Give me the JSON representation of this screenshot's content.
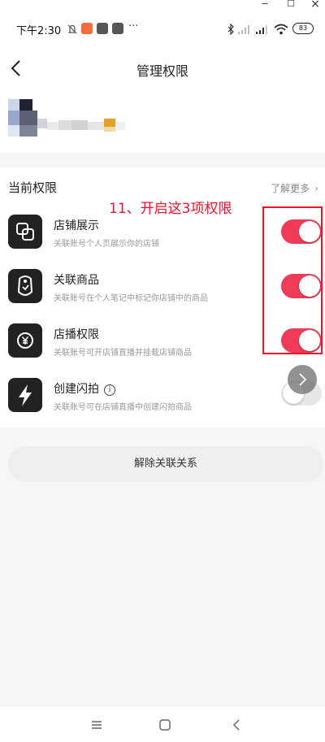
{
  "window": {
    "minimize": "−",
    "maximize": "☐",
    "close": "×"
  },
  "status_bar": {
    "time": "下午2:30",
    "more": "···",
    "battery": "83"
  },
  "header": {
    "title": "管理权限",
    "back_icon": "chevron-left-icon"
  },
  "permissions": {
    "section_title": "当前权限",
    "learn_more": "了解更多",
    "items": [
      {
        "title": "店铺展示",
        "desc": "关联账号个人页展示你的店铺",
        "icon": "store-display-icon",
        "enabled": true
      },
      {
        "title": "关联商品",
        "desc": "关联账号在个人笔记中标记你店铺中的商品",
        "icon": "tag-icon",
        "enabled": true
      },
      {
        "title": "店播权限",
        "desc": "关联账号可开店铺直播并挂载店铺商品",
        "icon": "yuan-icon",
        "enabled": true
      },
      {
        "title": "创建闪拍",
        "desc": "关联账号可在店铺直播中创建闪拍商品",
        "icon": "lightning-icon",
        "enabled": false,
        "info": "i"
      }
    ]
  },
  "annotation": {
    "text": "11、开启这3项权限",
    "color": "#e8182c"
  },
  "unlink_button": "解除关联关系",
  "colors": {
    "toggle_on": "#ef3b58",
    "toggle_off": "#e6e6e6",
    "annotation": "#e8182c"
  }
}
